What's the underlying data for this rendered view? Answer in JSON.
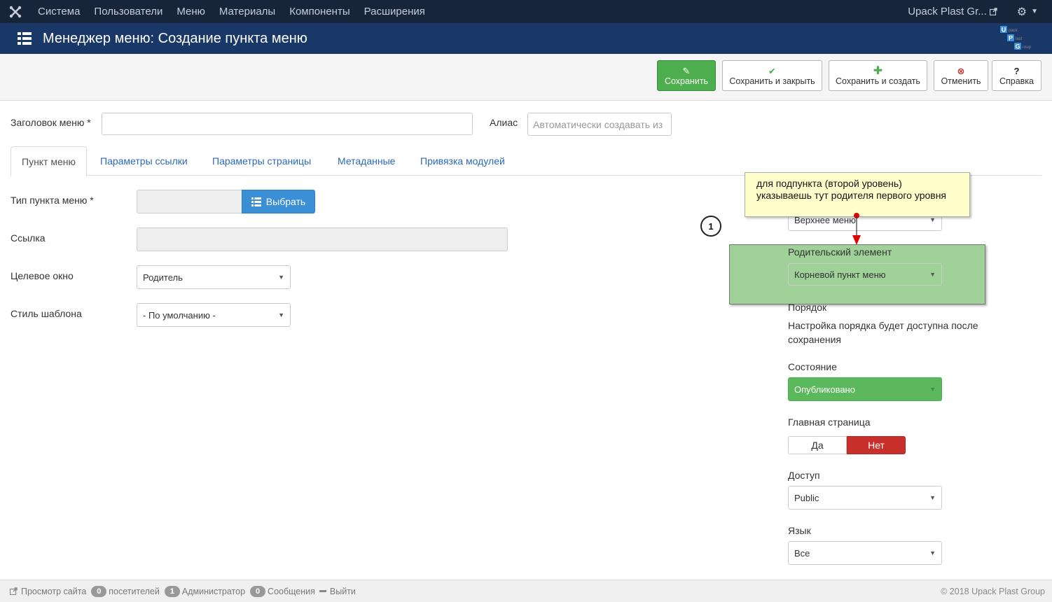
{
  "topbar": {
    "nav": [
      "Система",
      "Пользователи",
      "Меню",
      "Материалы",
      "Компоненты",
      "Расширения"
    ],
    "site_name": "Upack Plast Gr..."
  },
  "header": {
    "title": "Менеджер меню: Создание пункта меню",
    "logo_letters": [
      "U",
      "P",
      "G"
    ],
    "logo_words": [
      "pack",
      "last",
      "roup"
    ]
  },
  "toolbar": {
    "save": "Сохранить",
    "save_close": "Сохранить и закрыть",
    "save_new": "Сохранить и создать",
    "cancel": "Отменить",
    "help": "Справка"
  },
  "form": {
    "title_label": "Заголовок меню *",
    "title_value": "",
    "alias_label": "Алиас",
    "alias_placeholder": "Автоматически создавать из",
    "menu_type_label": "Тип пункта меню *",
    "choose_button": "Выбрать",
    "link_label": "Ссылка",
    "target_label": "Целевое окно",
    "target_value": "Родитель",
    "template_label": "Стиль шаблона",
    "template_value": "- По умолчанию -"
  },
  "tabs": [
    "Пункт меню",
    "Параметры ссылки",
    "Параметры страницы",
    "Метаданные",
    "Привязка модулей"
  ],
  "sidebar": {
    "menu_value": "Верхнее меню",
    "parent_label": "Родительский элемент",
    "parent_value": "Корневой пункт меню",
    "order_label": "Порядок",
    "order_text": "Настройка порядка будет доступна после сохранения",
    "status_label": "Состояние",
    "status_value": "Опубликовано",
    "home_label": "Главная страница",
    "home_yes": "Да",
    "home_no": "Нет",
    "access_label": "Доступ",
    "access_value": "Public",
    "language_label": "Язык",
    "language_value": "Все"
  },
  "annotation": {
    "line1": "для подпункта (второй уровень)",
    "line2": "указываешь тут родителя первого уровня",
    "number": "1"
  },
  "footer": {
    "view_site": "Просмотр сайта",
    "visitors_count": "0",
    "visitors_label": "посетителей",
    "admins_count": "1",
    "admins_label": "Администратор",
    "messages_count": "0",
    "messages_label": "Сообщения",
    "logout": "Выйти",
    "copyright": "© 2018 Upack Plast Group"
  },
  "colors": {
    "topbar": "#17243a",
    "titlebar": "#1a3867",
    "success": "#5cb85c",
    "danger": "#c9302c",
    "primary": "#3a8fd6",
    "link": "#2a69b8"
  }
}
